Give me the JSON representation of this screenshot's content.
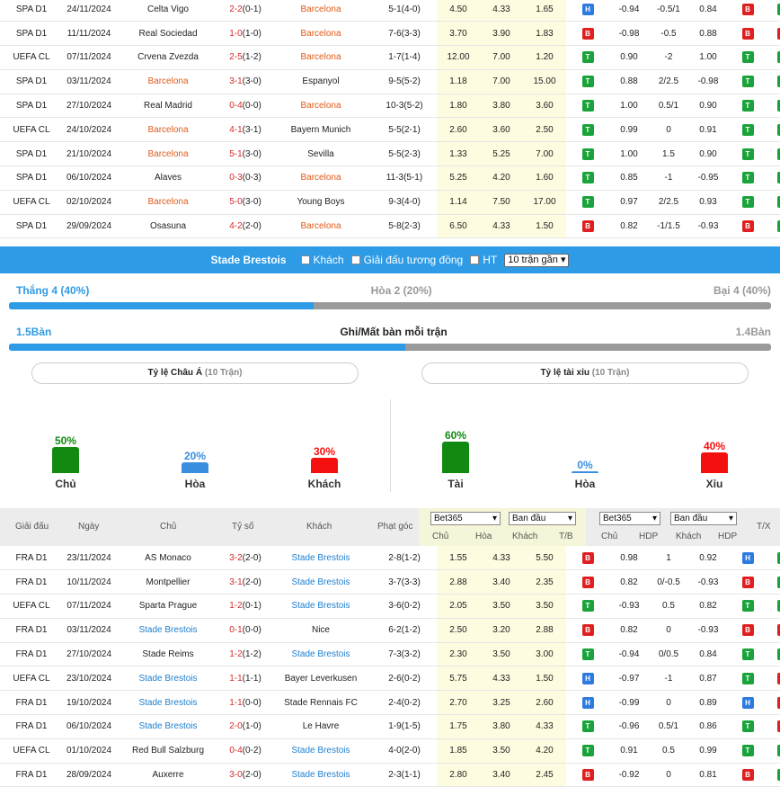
{
  "top_matches": [
    {
      "league": "SPA D1",
      "date": "24/11/2024",
      "home": "Celta Vigo",
      "home_hl": false,
      "score": "2-2",
      "score_ht": "(0-1)",
      "away": "Barcelona",
      "away_hl": true,
      "ht": "5-1(4-0)",
      "o1": "4.50",
      "o2": "4.33",
      "o3": "1.65",
      "tb": "H",
      "a1": "-0.94",
      "a2": "-0.5/1",
      "a3": "0.84",
      "a4": "B",
      "x": "T"
    },
    {
      "league": "SPA D1",
      "date": "11/11/2024",
      "home": "Real Sociedad",
      "home_hl": false,
      "score": "1-0",
      "score_ht": "(1-0)",
      "away": "Barcelona",
      "away_hl": true,
      "ht": "7-6(3-3)",
      "o1": "3.70",
      "o2": "3.90",
      "o3": "1.83",
      "tb": "B",
      "a1": "-0.98",
      "a2": "-0.5",
      "a3": "0.88",
      "a4": "B",
      "x": "X"
    },
    {
      "league": "UEFA CL",
      "date": "07/11/2024",
      "home": "Crvena Zvezda",
      "home_hl": false,
      "score": "2-5",
      "score_ht": "(1-2)",
      "away": "Barcelona",
      "away_hl": true,
      "ht": "1-7(1-4)",
      "o1": "12.00",
      "o2": "7.00",
      "o3": "1.20",
      "tb": "T",
      "a1": "0.90",
      "a2": "-2",
      "a3": "1.00",
      "a4": "T",
      "x": "T"
    },
    {
      "league": "SPA D1",
      "date": "03/11/2024",
      "home": "Barcelona",
      "home_hl": true,
      "score": "3-1",
      "score_ht": "(3-0)",
      "away": "Espanyol",
      "away_hl": false,
      "ht": "9-5(5-2)",
      "o1": "1.18",
      "o2": "7.00",
      "o3": "15.00",
      "tb": "T",
      "a1": "0.88",
      "a2": "2/2.5",
      "a3": "-0.98",
      "a4": "T",
      "x": "T"
    },
    {
      "league": "SPA D1",
      "date": "27/10/2024",
      "home": "Real Madrid",
      "home_hl": false,
      "score": "0-4",
      "score_ht": "(0-0)",
      "away": "Barcelona",
      "away_hl": true,
      "ht": "10-3(5-2)",
      "o1": "1.80",
      "o2": "3.80",
      "o3": "3.60",
      "tb": "T",
      "a1": "1.00",
      "a2": "0.5/1",
      "a3": "0.90",
      "a4": "T",
      "x": "T"
    },
    {
      "league": "UEFA CL",
      "date": "24/10/2024",
      "home": "Barcelona",
      "home_hl": true,
      "score": "4-1",
      "score_ht": "(3-1)",
      "away": "Bayern Munich",
      "away_hl": false,
      "ht": "5-5(2-1)",
      "o1": "2.60",
      "o2": "3.60",
      "o3": "2.50",
      "tb": "T",
      "a1": "0.99",
      "a2": "0",
      "a3": "0.91",
      "a4": "T",
      "x": "T"
    },
    {
      "league": "SPA D1",
      "date": "21/10/2024",
      "home": "Barcelona",
      "home_hl": true,
      "score": "5-1",
      "score_ht": "(3-0)",
      "away": "Sevilla",
      "away_hl": false,
      "ht": "5-5(2-3)",
      "o1": "1.33",
      "o2": "5.25",
      "o3": "7.00",
      "tb": "T",
      "a1": "1.00",
      "a2": "1.5",
      "a3": "0.90",
      "a4": "T",
      "x": "T"
    },
    {
      "league": "SPA D1",
      "date": "06/10/2024",
      "home": "Alaves",
      "home_hl": false,
      "score": "0-3",
      "score_ht": "(0-3)",
      "away": "Barcelona",
      "away_hl": true,
      "ht": "11-3(5-1)",
      "o1": "5.25",
      "o2": "4.20",
      "o3": "1.60",
      "tb": "T",
      "a1": "0.85",
      "a2": "-1",
      "a3": "-0.95",
      "a4": "T",
      "x": "T"
    },
    {
      "league": "UEFA CL",
      "date": "02/10/2024",
      "home": "Barcelona",
      "home_hl": true,
      "score": "5-0",
      "score_ht": "(3-0)",
      "away": "Young Boys",
      "away_hl": false,
      "ht": "9-3(4-0)",
      "o1": "1.14",
      "o2": "7.50",
      "o3": "17.00",
      "tb": "T",
      "a1": "0.97",
      "a2": "2/2.5",
      "a3": "0.93",
      "a4": "T",
      "x": "T"
    },
    {
      "league": "SPA D1",
      "date": "29/09/2024",
      "home": "Osasuna",
      "home_hl": false,
      "score": "4-2",
      "score_ht": "(2-0)",
      "away": "Barcelona",
      "away_hl": true,
      "ht": "5-8(2-3)",
      "o1": "6.50",
      "o2": "4.33",
      "o3": "1.50",
      "tb": "B",
      "a1": "0.82",
      "a2": "-1/1.5",
      "a3": "-0.93",
      "a4": "B",
      "x": "T"
    }
  ],
  "filter": {
    "team": "Stade Brestois",
    "opt_away": "Khách",
    "opt_same_league": "Giải đấu tương đồng",
    "opt_ht": "HT",
    "recent_select": "10 trận gần"
  },
  "results": {
    "win_label": "Thắng 4 (40%)",
    "draw_label": "Hòa 2 (20%)",
    "loss_label": "Bại 4 (40%)",
    "win_fraction": 0.4
  },
  "goals": {
    "for_label": "1.5Bàn",
    "title": "Ghi/Mất bàn mỗi trận",
    "against_label": "1.4Bàn",
    "for_fraction": 0.52
  },
  "asian": {
    "title": "Tỷ lệ Châu Á",
    "subtitle": "(10 Trận)",
    "cols": [
      {
        "pct": "50%",
        "value": 0.5,
        "name": "Chủ",
        "color": "#128a12"
      },
      {
        "pct": "20%",
        "value": 0.2,
        "name": "Hòa",
        "color": "#3a8ee0"
      },
      {
        "pct": "30%",
        "value": 0.3,
        "name": "Khách",
        "color": "#f51010"
      }
    ]
  },
  "overunder": {
    "title": "Tỷ lệ tài xỉu",
    "subtitle": "(10 Trận)",
    "cols": [
      {
        "pct": "60%",
        "value": 0.6,
        "name": "Tài",
        "color": "#128a12"
      },
      {
        "pct": "0%",
        "value": 0.0,
        "name": "Hòa",
        "color": "#3a8ee0"
      },
      {
        "pct": "40%",
        "value": 0.4,
        "name": "Xỉu",
        "color": "#f51010"
      }
    ]
  },
  "table_header": {
    "league": "Giải đấu",
    "date": "Ngày",
    "home": "Chủ",
    "score": "Tỷ số",
    "away": "Khách",
    "corner": "Phạt góc",
    "bookie1": "Bet365",
    "period1": "Ban đầu",
    "bookie2": "Bet365",
    "period2": "Ban đầu",
    "h_chu": "Chủ",
    "h_hoa": "Hòa",
    "h_khach": "Khách",
    "h_tb": "T/B",
    "h_chu2": "Chủ",
    "h_hdp": "HDP",
    "h_khach2": "Khách",
    "h_hdp2": "HDP",
    "h_tx": "T/X"
  },
  "bottom_matches": [
    {
      "league": "FRA D1",
      "date": "23/11/2024",
      "home": "AS Monaco",
      "home_hl": false,
      "score": "3-2",
      "score_ht": "(2-0)",
      "away": "Stade Brestois",
      "away_hl": true,
      "ht": "2-8(1-2)",
      "o1": "1.55",
      "o2": "4.33",
      "o3": "5.50",
      "tb": "B",
      "a1": "0.98",
      "a2": "1",
      "a3": "0.92",
      "a4": "H",
      "x": "T"
    },
    {
      "league": "FRA D1",
      "date": "10/11/2024",
      "home": "Montpellier",
      "home_hl": false,
      "score": "3-1",
      "score_ht": "(2-0)",
      "away": "Stade Brestois",
      "away_hl": true,
      "ht": "3-7(3-3)",
      "o1": "2.88",
      "o2": "3.40",
      "o3": "2.35",
      "tb": "B",
      "a1": "0.82",
      "a2": "0/-0.5",
      "a3": "-0.93",
      "a4": "B",
      "x": "T"
    },
    {
      "league": "UEFA CL",
      "date": "07/11/2024",
      "home": "Sparta Prague",
      "home_hl": false,
      "score": "1-2",
      "score_ht": "(0-1)",
      "away": "Stade Brestois",
      "away_hl": true,
      "ht": "3-6(0-2)",
      "o1": "2.05",
      "o2": "3.50",
      "o3": "3.50",
      "tb": "T",
      "a1": "-0.93",
      "a2": "0.5",
      "a3": "0.82",
      "a4": "T",
      "x": "T"
    },
    {
      "league": "FRA D1",
      "date": "03/11/2024",
      "home": "Stade Brestois",
      "home_hl": true,
      "score": "0-1",
      "score_ht": "(0-0)",
      "away": "Nice",
      "away_hl": false,
      "ht": "6-2(1-2)",
      "o1": "2.50",
      "o2": "3.20",
      "o3": "2.88",
      "tb": "B",
      "a1": "0.82",
      "a2": "0",
      "a3": "-0.93",
      "a4": "B",
      "x": "X"
    },
    {
      "league": "FRA D1",
      "date": "27/10/2024",
      "home": "Stade Reims",
      "home_hl": false,
      "score": "1-2",
      "score_ht": "(1-2)",
      "away": "Stade Brestois",
      "away_hl": true,
      "ht": "7-3(3-2)",
      "o1": "2.30",
      "o2": "3.50",
      "o3": "3.00",
      "tb": "T",
      "a1": "-0.94",
      "a2": "0/0.5",
      "a3": "0.84",
      "a4": "T",
      "x": "T"
    },
    {
      "league": "UEFA CL",
      "date": "23/10/2024",
      "home": "Stade Brestois",
      "home_hl": true,
      "score": "1-1",
      "score_ht": "(1-1)",
      "away": "Bayer Leverkusen",
      "away_hl": false,
      "ht": "2-6(0-2)",
      "o1": "5.75",
      "o2": "4.33",
      "o3": "1.50",
      "tb": "H",
      "a1": "-0.97",
      "a2": "-1",
      "a3": "0.87",
      "a4": "T",
      "x": "X"
    },
    {
      "league": "FRA D1",
      "date": "19/10/2024",
      "home": "Stade Brestois",
      "home_hl": true,
      "score": "1-1",
      "score_ht": "(0-0)",
      "away": "Stade Rennais FC",
      "away_hl": false,
      "ht": "2-4(0-2)",
      "o1": "2.70",
      "o2": "3.25",
      "o3": "2.60",
      "tb": "H",
      "a1": "-0.99",
      "a2": "0",
      "a3": "0.89",
      "a4": "H",
      "x": "X"
    },
    {
      "league": "FRA D1",
      "date": "06/10/2024",
      "home": "Stade Brestois",
      "home_hl": true,
      "score": "2-0",
      "score_ht": "(1-0)",
      "away": "Le Havre",
      "away_hl": false,
      "ht": "1-9(1-5)",
      "o1": "1.75",
      "o2": "3.80",
      "o3": "4.33",
      "tb": "T",
      "a1": "-0.96",
      "a2": "0.5/1",
      "a3": "0.86",
      "a4": "T",
      "x": "X"
    },
    {
      "league": "UEFA CL",
      "date": "01/10/2024",
      "home": "Red Bull Salzburg",
      "home_hl": false,
      "score": "0-4",
      "score_ht": "(0-2)",
      "away": "Stade Brestois",
      "away_hl": true,
      "ht": "4-0(2-0)",
      "o1": "1.85",
      "o2": "3.50",
      "o3": "4.20",
      "tb": "T",
      "a1": "0.91",
      "a2": "0.5",
      "a3": "0.99",
      "a4": "T",
      "x": "T"
    },
    {
      "league": "FRA D1",
      "date": "28/09/2024",
      "home": "Auxerre",
      "home_hl": false,
      "score": "3-0",
      "score_ht": "(2-0)",
      "away": "Stade Brestois",
      "away_hl": true,
      "ht": "2-3(1-1)",
      "o1": "2.80",
      "o2": "3.40",
      "o3": "2.45",
      "tb": "B",
      "a1": "-0.92",
      "a2": "0",
      "a3": "0.81",
      "a4": "B",
      "x": "T"
    }
  ]
}
